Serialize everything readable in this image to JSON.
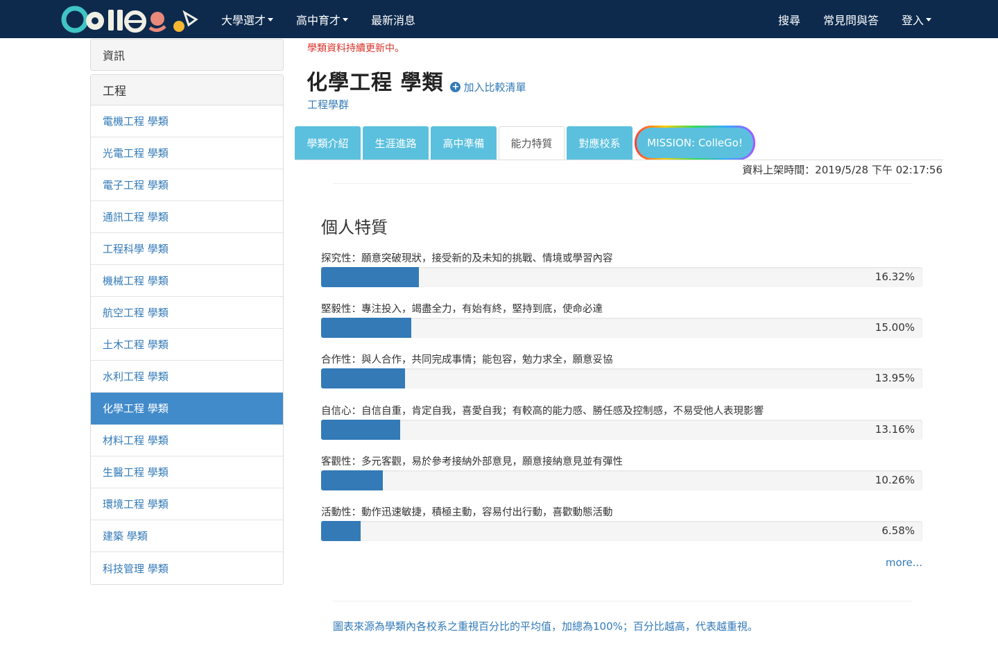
{
  "colors": {
    "navbar": "#0d2a4d",
    "tab": "#5bc0de",
    "bar": "#337ab7",
    "active_side": "#428bca",
    "notice": "#d9332b"
  },
  "navbar": {
    "left": [
      {
        "label": "大學選才",
        "caret": true
      },
      {
        "label": "高中育才",
        "caret": true
      },
      {
        "label": "最新消息",
        "caret": false
      }
    ],
    "right": [
      {
        "label": "搜尋",
        "caret": false
      },
      {
        "label": "常見問與答",
        "caret": false
      },
      {
        "label": "登入",
        "caret": true
      }
    ]
  },
  "sidebar": {
    "info_label": "資訊",
    "group_label": "工程",
    "items": [
      "電機工程 學類",
      "光電工程 學類",
      "電子工程 學類",
      "通訊工程 學類",
      "工程科學 學類",
      "機械工程 學類",
      "航空工程 學類",
      "土木工程 學類",
      "水利工程 學類",
      "化學工程 學類",
      "材料工程 學類",
      "生醫工程 學類",
      "環境工程 學類",
      "建築 學類",
      "科技管理 學類"
    ],
    "active_index": 9
  },
  "main": {
    "notice": "學類資料持續更新中。",
    "title": "化學工程 學類",
    "compare_label": "加入比較清單",
    "group_link": "工程學群",
    "tabs": [
      {
        "label": "學類介紹",
        "width": 95
      },
      {
        "label": "生涯進路",
        "width": 95
      },
      {
        "label": "高中準備",
        "width": 95
      },
      {
        "label": "能力特質",
        "width": 95
      },
      {
        "label": "對應校系",
        "width": 95
      },
      {
        "label": "MISSION: ColleGo!",
        "width": 174
      }
    ],
    "active_tab": 3,
    "timestamp": "資料上架時間：2019/5/28 下午 02:17:56",
    "section_title": "個人特質",
    "traits": [
      {
        "label": "探究性：願意突破現狀，接受新的及未知的挑戰、情境或學習內容",
        "value": "16.32%",
        "percent": 16.32
      },
      {
        "label": "堅毅性：專注投入，竭盡全力，有始有終，堅持到底，使命必達",
        "value": "15.00%",
        "percent": 15.0
      },
      {
        "label": "合作性：與人合作，共同完成事情；能包容，勉力求全，願意妥協",
        "value": "13.95%",
        "percent": 13.95
      },
      {
        "label": "自信心：自信自重，肯定自我，喜愛自我；有較高的能力感、勝任感及控制感，不易受他人表現影響",
        "value": "13.16%",
        "percent": 13.16
      },
      {
        "label": "客觀性：多元客觀，易於參考接納外部意見，願意接納意見並有彈性",
        "value": "10.26%",
        "percent": 10.26
      },
      {
        "label": "活動性：動作迅速敏捷，積極主動，容易付出行動，喜歡動態活動",
        "value": "6.58%",
        "percent": 6.58
      }
    ],
    "more_label": "more...",
    "footnote": "圖表來源為學類內各校系之重視百分比的平均值，加總為100%；百分比越高，代表越重視。"
  }
}
